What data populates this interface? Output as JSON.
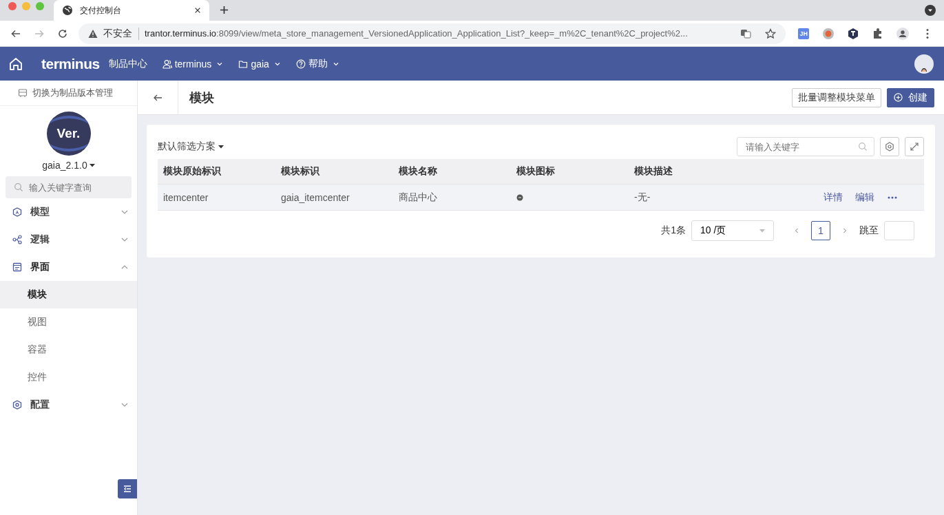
{
  "browser": {
    "tab_title": "交付控制台",
    "security": "不安全",
    "url_host": "trantor.terminus.io",
    "url_rest": ":8099/view/meta_store_management_VersionedApplication_Application_List?_keep=_m%2C_tenant%2C_project%2...",
    "ext_badge": "JH"
  },
  "header": {
    "logo": "terminus",
    "nav": [
      {
        "label": "制品中心",
        "kind": "plain"
      },
      {
        "label": "terminus",
        "kind": "user"
      },
      {
        "label": "gaia",
        "kind": "folder"
      },
      {
        "label": "帮助",
        "kind": "help"
      }
    ]
  },
  "sidebar": {
    "switch_label": "切换为制品版本管理",
    "avatar_text": "Ver.",
    "version": "gaia_2.1.0",
    "search": {
      "placeholder": "输入关键字查询"
    },
    "items": [
      {
        "label": "模型",
        "expanded": false
      },
      {
        "label": "逻辑",
        "expanded": false
      },
      {
        "label": "界面",
        "expanded": true,
        "children": [
          {
            "label": "模块",
            "selected": true
          },
          {
            "label": "视图",
            "selected": false
          },
          {
            "label": "容器",
            "selected": false
          },
          {
            "label": "控件",
            "selected": false
          }
        ]
      },
      {
        "label": "配置",
        "expanded": false
      }
    ]
  },
  "page": {
    "title": "模块",
    "buttons": [
      {
        "label": "批量调整模块菜单",
        "kind": "default"
      },
      {
        "label": "创建",
        "kind": "primary"
      }
    ]
  },
  "table": {
    "filter": "默认筛选方案",
    "search": {
      "placeholder": "请输入关键字"
    },
    "columns": [
      "模块原始标识",
      "模块标识",
      "模块名称",
      "模块图标",
      "模块描述"
    ],
    "rows": [
      {
        "cells": [
          "itemcenter",
          "gaia_itemcenter",
          "商品中心",
          "",
          "-无-"
        ],
        "actions": [
          "详情",
          "编辑"
        ]
      }
    ]
  },
  "pagination": {
    "total": "共1条",
    "page_size": "10 /页",
    "pages": [
      {
        "label": "1",
        "selected": true
      }
    ],
    "jump_label": "跳至"
  }
}
